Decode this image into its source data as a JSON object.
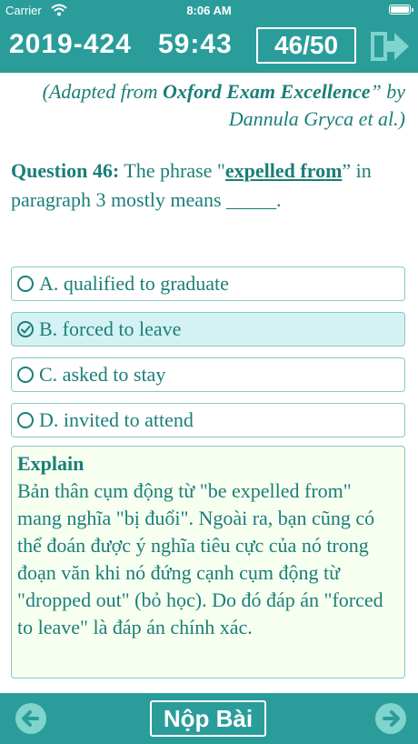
{
  "status": {
    "carrier": "Carrier",
    "time": "8:06 AM"
  },
  "header": {
    "exam_code": "2019-424",
    "timer": "59:43",
    "progress": "46/50"
  },
  "source": {
    "prefix": "(Adapted from ",
    "book": "Oxford Exam Excellence",
    "suffix": "” by Dannula Gryca et al.)"
  },
  "question": {
    "number": "Question 46:",
    "before": " The phrase \"",
    "phrase": "expelled from",
    "after": "” in paragraph 3 mostly means _____."
  },
  "options": [
    {
      "label": "A. qualified to graduate",
      "selected": false
    },
    {
      "label": "B. forced to leave",
      "selected": true
    },
    {
      "label": "C. asked to stay",
      "selected": false
    },
    {
      "label": "D. invited to attend",
      "selected": false
    }
  ],
  "explain": {
    "title": "Explain",
    "body": "Bản thân cụm động từ \"be expelled from\" mang nghĩa \"bị đuổi\". Ngoài ra, bạn cũng có thể đoán được ý nghĩa tiêu cực của nó trong đoạn văn khi nó đứng cạnh cụm động từ \"dropped out\" (bỏ học). Do đó đáp án \"forced to leave\" là đáp án chính xác."
  },
  "footer": {
    "submit_label": "Nộp Bài"
  },
  "colors": {
    "primary": "#2a9d9a",
    "text": "#1a7e78",
    "selected_bg": "#d4f2f3",
    "explain_bg": "#f6fff0",
    "icon_light": "#7fd4cc"
  },
  "icons": {
    "exit": "exit-arrow-icon",
    "prev": "arrow-left-icon",
    "next": "arrow-right-icon",
    "selected": "check-circle-icon",
    "unselected": "radio-circle-icon"
  }
}
